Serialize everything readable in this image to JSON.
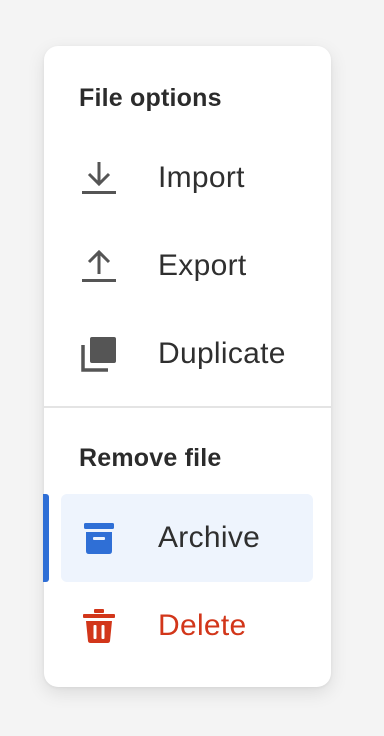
{
  "menu": {
    "sections": [
      {
        "title": "File options",
        "items": [
          {
            "label": "Import",
            "icon": "download-icon"
          },
          {
            "label": "Export",
            "icon": "upload-icon"
          },
          {
            "label": "Duplicate",
            "icon": "duplicate-icon"
          }
        ]
      },
      {
        "title": "Remove file",
        "items": [
          {
            "label": "Archive",
            "icon": "archive-icon",
            "selected": true
          },
          {
            "label": "Delete",
            "icon": "trash-icon",
            "danger": true
          }
        ]
      }
    ]
  },
  "colors": {
    "icon_default": "#555555",
    "accent": "#2f6fd6",
    "selected_bg": "#eef4fd",
    "danger": "#d2361a"
  }
}
